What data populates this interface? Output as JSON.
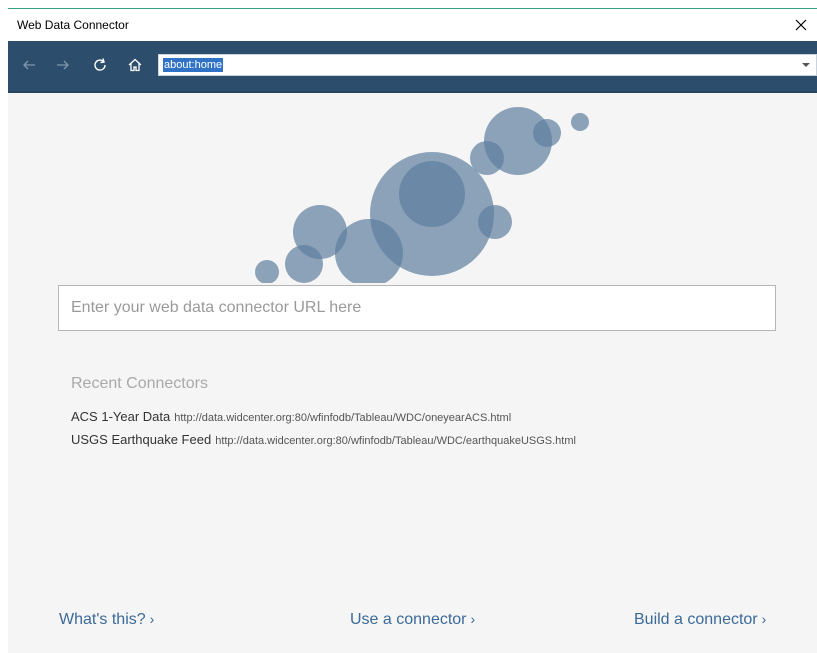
{
  "window": {
    "title": "Web Data Connector"
  },
  "toolbar": {
    "url": "about:home",
    "icons": [
      "back-arrow-icon",
      "forward-arrow-icon",
      "refresh-icon",
      "home-icon",
      "chevron-down-icon"
    ]
  },
  "main": {
    "url_input_placeholder": "Enter your web data connector URL here",
    "recent_heading": "Recent Connectors",
    "recent_connectors": [
      {
        "name": "ACS 1-Year Data",
        "url": "http://data.widcenter.org:80/wfinfodb/Tableau/WDC/oneyearACS.html"
      },
      {
        "name": "USGS Earthquake Feed",
        "url": "http://data.widcenter.org:80/wfinfodb/Tableau/WDC/earthquakeUSGS.html"
      }
    ]
  },
  "footer": {
    "whats_this": "What's this?",
    "use_connector": "Use a connector",
    "build_connector": "Build a connector"
  },
  "colors": {
    "toolbar_bg": "#2c4e6c",
    "bubble": "#5e7fa0",
    "link": "#3c6a98"
  }
}
